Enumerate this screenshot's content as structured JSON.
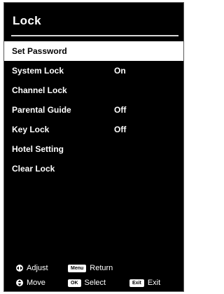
{
  "title": "Lock",
  "menu": {
    "items": [
      {
        "label": "Set Password",
        "value": "",
        "selected": true
      },
      {
        "label": "System Lock",
        "value": "On",
        "selected": false
      },
      {
        "label": "Channel Lock",
        "value": "",
        "selected": false
      },
      {
        "label": "Parental Guide",
        "value": "Off",
        "selected": false
      },
      {
        "label": "Key Lock",
        "value": "Off",
        "selected": false
      },
      {
        "label": "Hotel Setting",
        "value": "",
        "selected": false
      },
      {
        "label": "Clear Lock",
        "value": "",
        "selected": false
      }
    ]
  },
  "footer": {
    "adjust": {
      "icon": "left-right-arrows-icon",
      "label": "Adjust"
    },
    "return": {
      "key": "Menu",
      "label": "Return"
    },
    "move": {
      "icon": "up-down-arrows-icon",
      "label": "Move"
    },
    "select": {
      "key": "OK",
      "label": "Select"
    },
    "exit": {
      "key": "Exit",
      "label": "Exit"
    }
  },
  "colors": {
    "background": "#000000",
    "highlight": "#ffffff",
    "text": "#ffffff"
  }
}
